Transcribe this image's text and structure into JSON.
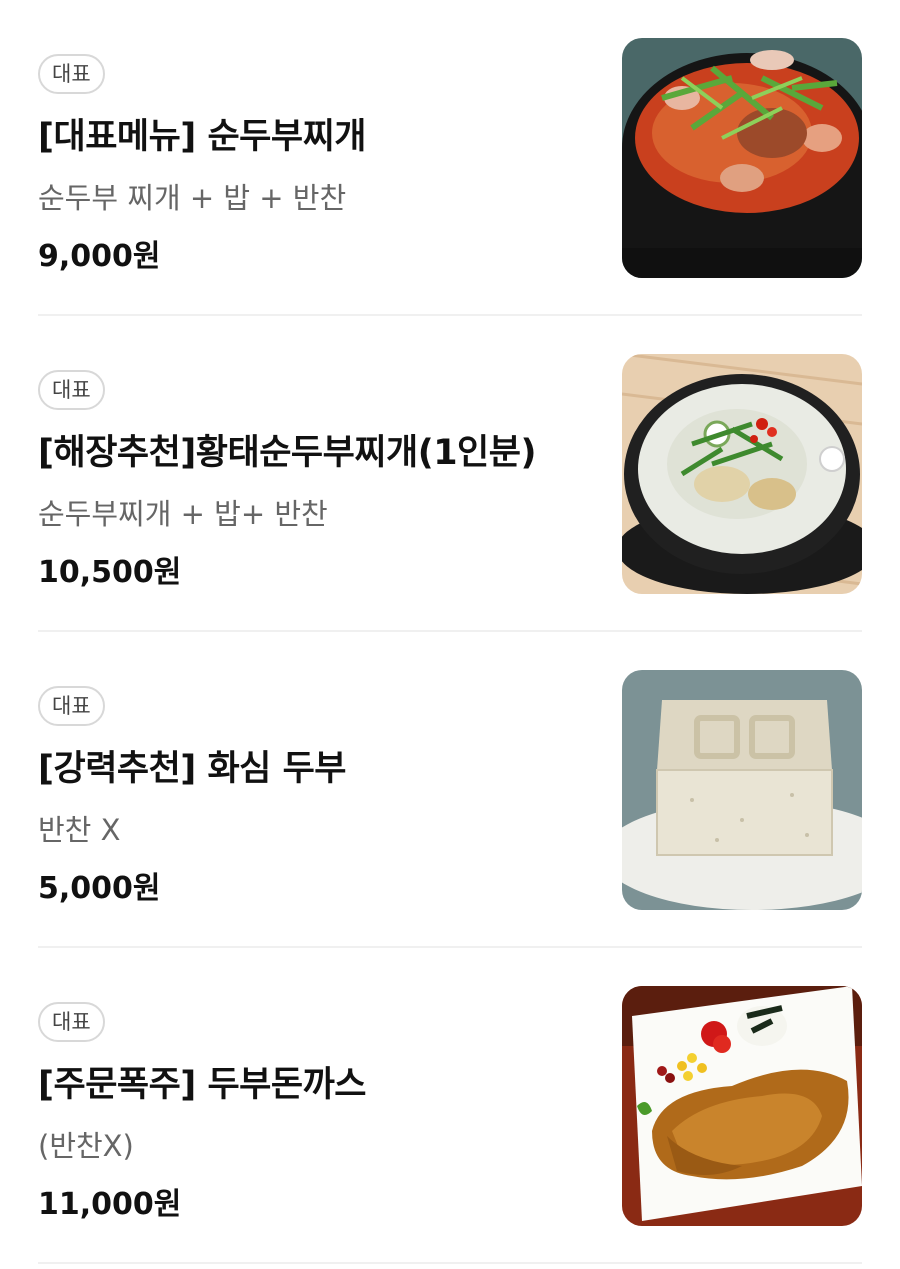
{
  "menu": [
    {
      "badge": "대표",
      "name": "[대표메뉴] 순두부찌개",
      "desc": "순두부 찌개 + 밥 + 반찬",
      "price": "9,000원",
      "image": "sundubu-jjigae-photo"
    },
    {
      "badge": "대표",
      "name": "[해장추천]황태순두부찌개(1인분)",
      "desc": "순두부찌개 + 밥+ 반찬",
      "price": "10,500원",
      "image": "hwangtae-sundubu-photo"
    },
    {
      "badge": "대표",
      "name": "[강력추천] 화심 두부",
      "desc": "반찬 X",
      "price": "5,000원",
      "image": "tofu-block-photo"
    },
    {
      "badge": "대표",
      "name": "[주문폭주] 두부돈까스",
      "desc": "(반찬X)",
      "price": "11,000원",
      "image": "tofu-donkatsu-photo"
    }
  ]
}
